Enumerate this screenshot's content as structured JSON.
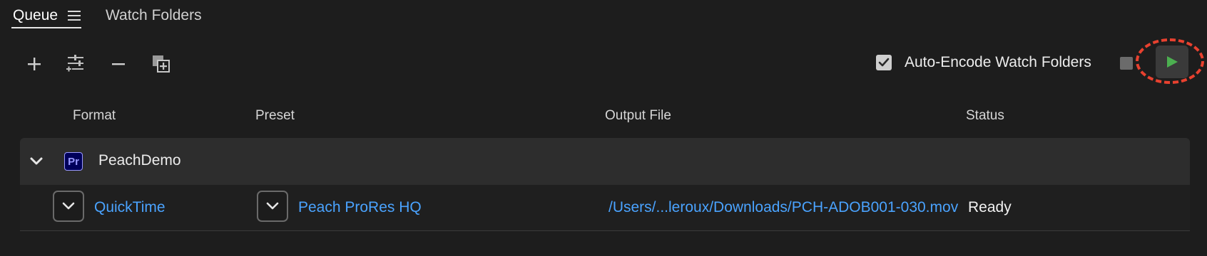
{
  "tabs": [
    {
      "label": "Queue"
    },
    {
      "label": "Watch Folders"
    }
  ],
  "toolbar": {
    "auto_encode_label": "Auto-Encode Watch Folders",
    "auto_encode_checked": true,
    "icons": [
      "add-icon",
      "preset-settings-icon",
      "remove-icon",
      "duplicate-icon",
      "stop-icon",
      "play-icon"
    ]
  },
  "columns": {
    "format": "Format",
    "preset": "Preset",
    "output": "Output File",
    "status": "Status"
  },
  "queue": {
    "group": {
      "badge": "Pr",
      "name": "PeachDemo"
    },
    "items": [
      {
        "format": "QuickTime",
        "preset": "Peach ProRes HQ",
        "output": "/Users/...leroux/Downloads/PCH-ADOB001-030.mov",
        "status": "Ready"
      }
    ]
  },
  "colors": {
    "link": "#4aa3ff",
    "play": "#4caf50",
    "highlight": "#e8412f",
    "premiere_bg": "#00005b",
    "premiere_fg": "#9999ff"
  }
}
